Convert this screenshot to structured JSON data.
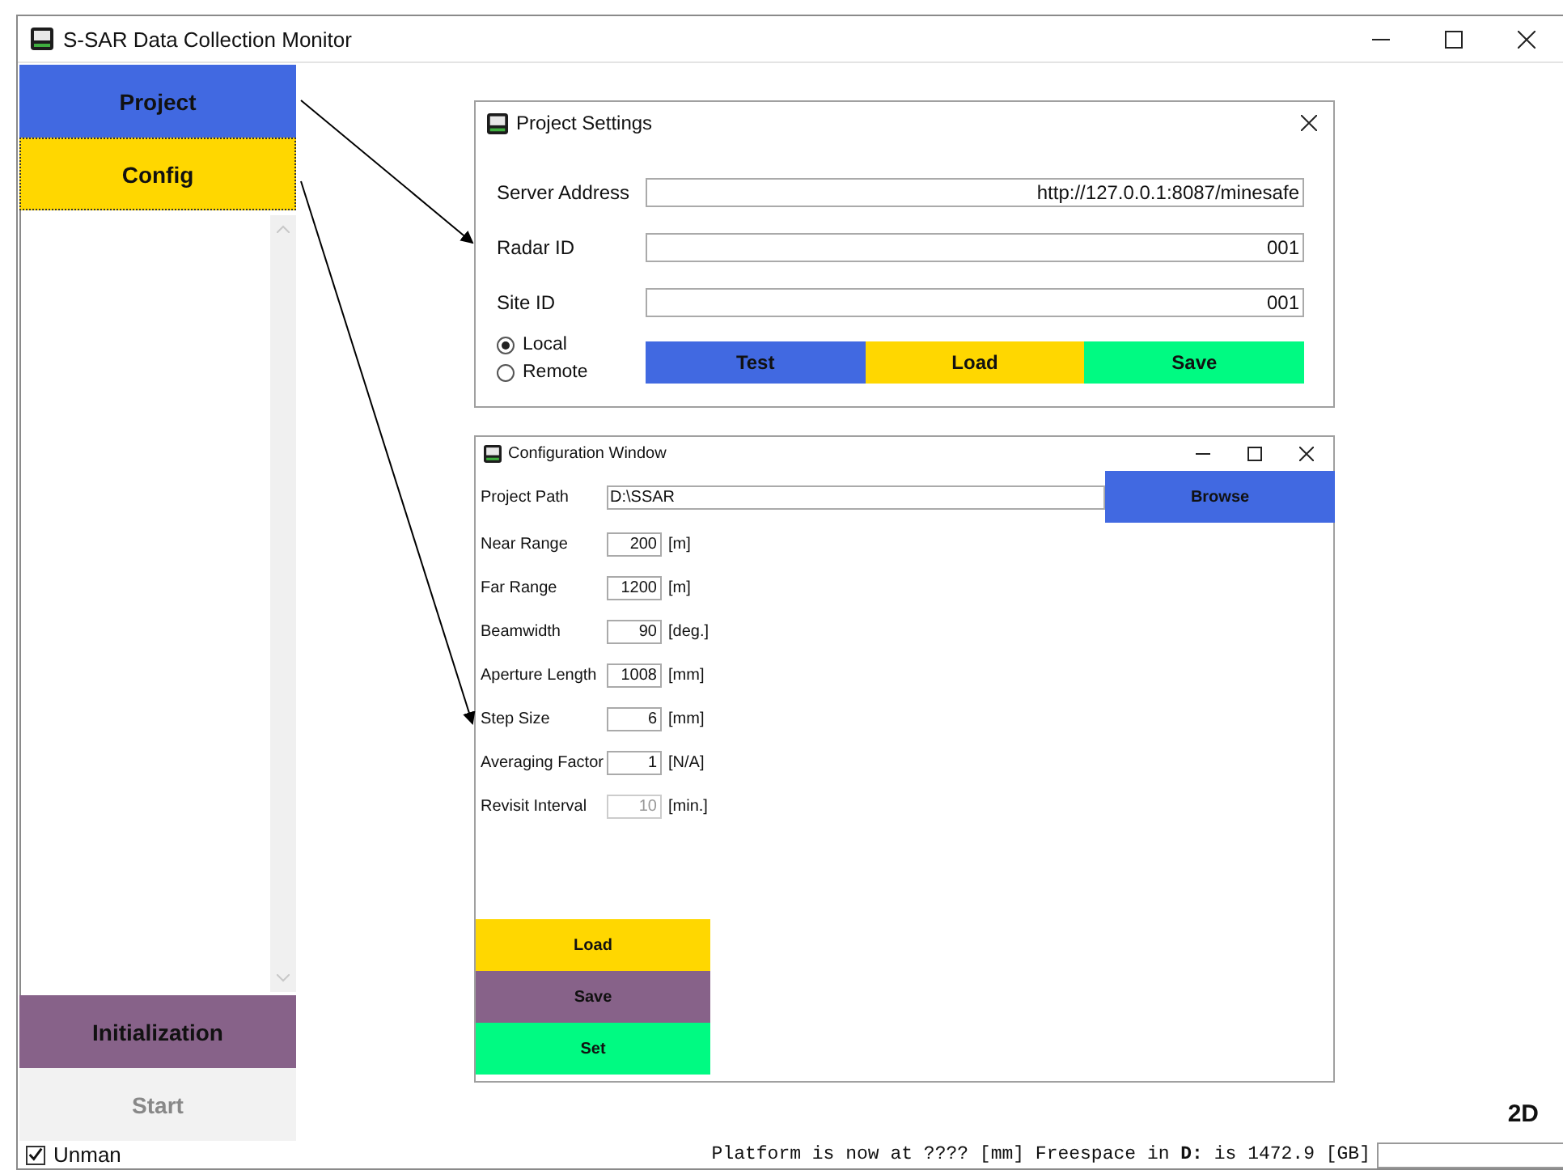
{
  "window": {
    "title": "S-SAR Data Collection Monitor"
  },
  "sidebar": {
    "items": [
      {
        "label": "Project",
        "color": "#4169e1",
        "focused": false,
        "disabled": false
      },
      {
        "label": "Config",
        "color": "#ffd700",
        "focused": true,
        "disabled": false
      }
    ],
    "bottom_items": [
      {
        "label": "Initialization",
        "color": "#876289",
        "focused": false,
        "disabled": false
      },
      {
        "label": "Start",
        "color": "#f2f2f2",
        "focused": false,
        "disabled": true
      }
    ]
  },
  "project_settings": {
    "title": "Project Settings",
    "fields": [
      {
        "label": "Server Address",
        "value": "http://127.0.0.1:8087/minesafe"
      },
      {
        "label": "Radar ID",
        "value": "001"
      },
      {
        "label": "Site ID",
        "value": "001"
      }
    ],
    "connection": [
      {
        "label": "Local",
        "selected": true
      },
      {
        "label": "Remote",
        "selected": false
      }
    ],
    "buttons": [
      {
        "label": "Test",
        "color": "#4169e1"
      },
      {
        "label": "Load",
        "color": "#ffd700"
      },
      {
        "label": "Save",
        "color": "#00fa82"
      }
    ]
  },
  "config_window": {
    "title": "Configuration Window",
    "project_path": {
      "label": "Project Path",
      "value": "D:\\SSAR"
    },
    "browse_button": {
      "label": "Browse",
      "color": "#4169e1"
    },
    "params": [
      {
        "label": "Near Range",
        "value": "200",
        "unit": "[m]",
        "disabled": false
      },
      {
        "label": "Far Range",
        "value": "1200",
        "unit": "[m]",
        "disabled": false
      },
      {
        "label": "Beamwidth",
        "value": "90",
        "unit": "[deg.]",
        "disabled": false
      },
      {
        "label": "Aperture Length",
        "value": "1008",
        "unit": "[mm]",
        "disabled": false
      },
      {
        "label": "Step Size",
        "value": "6",
        "unit": "[mm]",
        "disabled": false
      },
      {
        "label": "Averaging Factor",
        "value": "1",
        "unit": "[N/A]",
        "disabled": false
      },
      {
        "label": "Revisit Interval",
        "value": "10",
        "unit": "[min.]",
        "disabled": true
      }
    ],
    "buttons": [
      {
        "label": "Load",
        "color": "#ffd700"
      },
      {
        "label": "Save",
        "color": "#876289"
      },
      {
        "label": "Set",
        "color": "#00fa82"
      }
    ]
  },
  "view_mode": "2D",
  "status_bar": {
    "unman": {
      "label": "Unman",
      "checked": true
    },
    "message": "Platform is now at ???? [mm] Freespace in **D:** is 1472.9 [GB]"
  }
}
